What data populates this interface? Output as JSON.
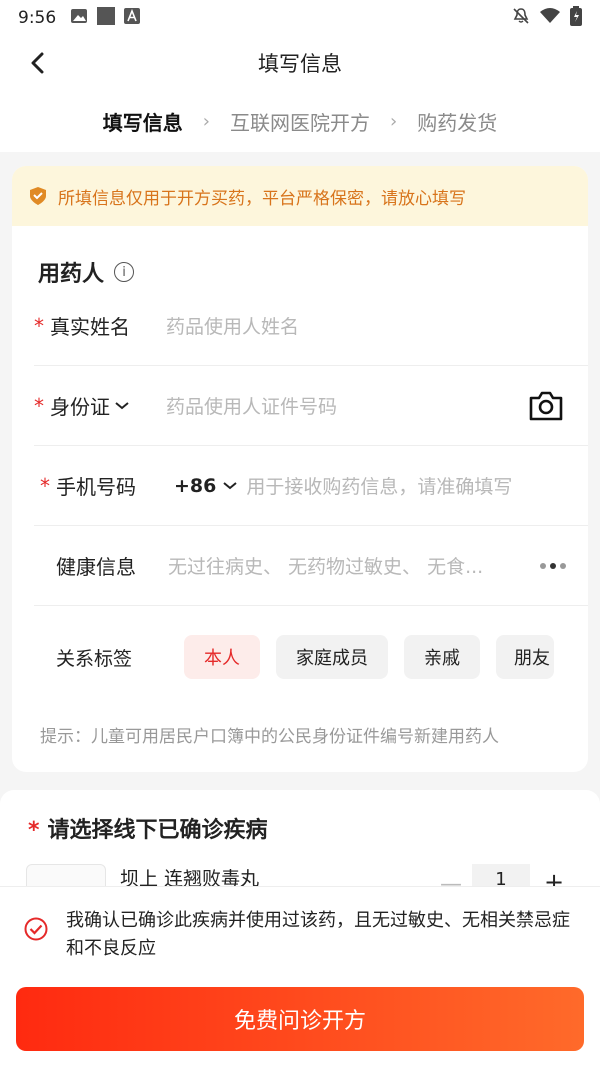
{
  "status_bar": {
    "time": "9:56"
  },
  "header": {
    "title": "填写信息"
  },
  "steps": [
    {
      "label": "填写信息",
      "active": true
    },
    {
      "label": "互联网医院开方",
      "active": false
    },
    {
      "label": "购药发货",
      "active": false
    }
  ],
  "notice": {
    "text": "所填信息仅用于开方买药，平台严格保密，请放心填写"
  },
  "patient": {
    "title": "用药人",
    "name_label": "真实姓名",
    "name_placeholder": "药品使用人姓名",
    "id_label": "身份证",
    "id_placeholder": "药品使用人证件号码",
    "phone_label": "手机号码",
    "country_code": "+86",
    "phone_placeholder": "用于接收购药信息，请准确填写",
    "health_label": "健康信息",
    "health_placeholder": "无过往病史、 无药物过敏史、 无食...",
    "relation_label": "关系标签",
    "relation_tags": [
      "本人",
      "家庭成员",
      "亲戚",
      "朋友"
    ],
    "selected_tag": "本人",
    "hint": "提示：儿童可用居民户口簿中的公民身份证件编号新建用药人"
  },
  "disease": {
    "title": "请选择线下已确诊疾病",
    "medicine_name": "坝上 连翘败毒丸",
    "quantity": "1",
    "minus": "—",
    "plus": "+"
  },
  "agreement": {
    "text": "我确认已确诊此疾病并使用过该药，且无过敏史、无相关禁忌症和不良反应"
  },
  "cta": {
    "label": "免费问诊开方"
  },
  "colors": {
    "accent": "#e52a2a",
    "notice_bg": "#fdf6dc",
    "notice_text": "#d8741b"
  }
}
